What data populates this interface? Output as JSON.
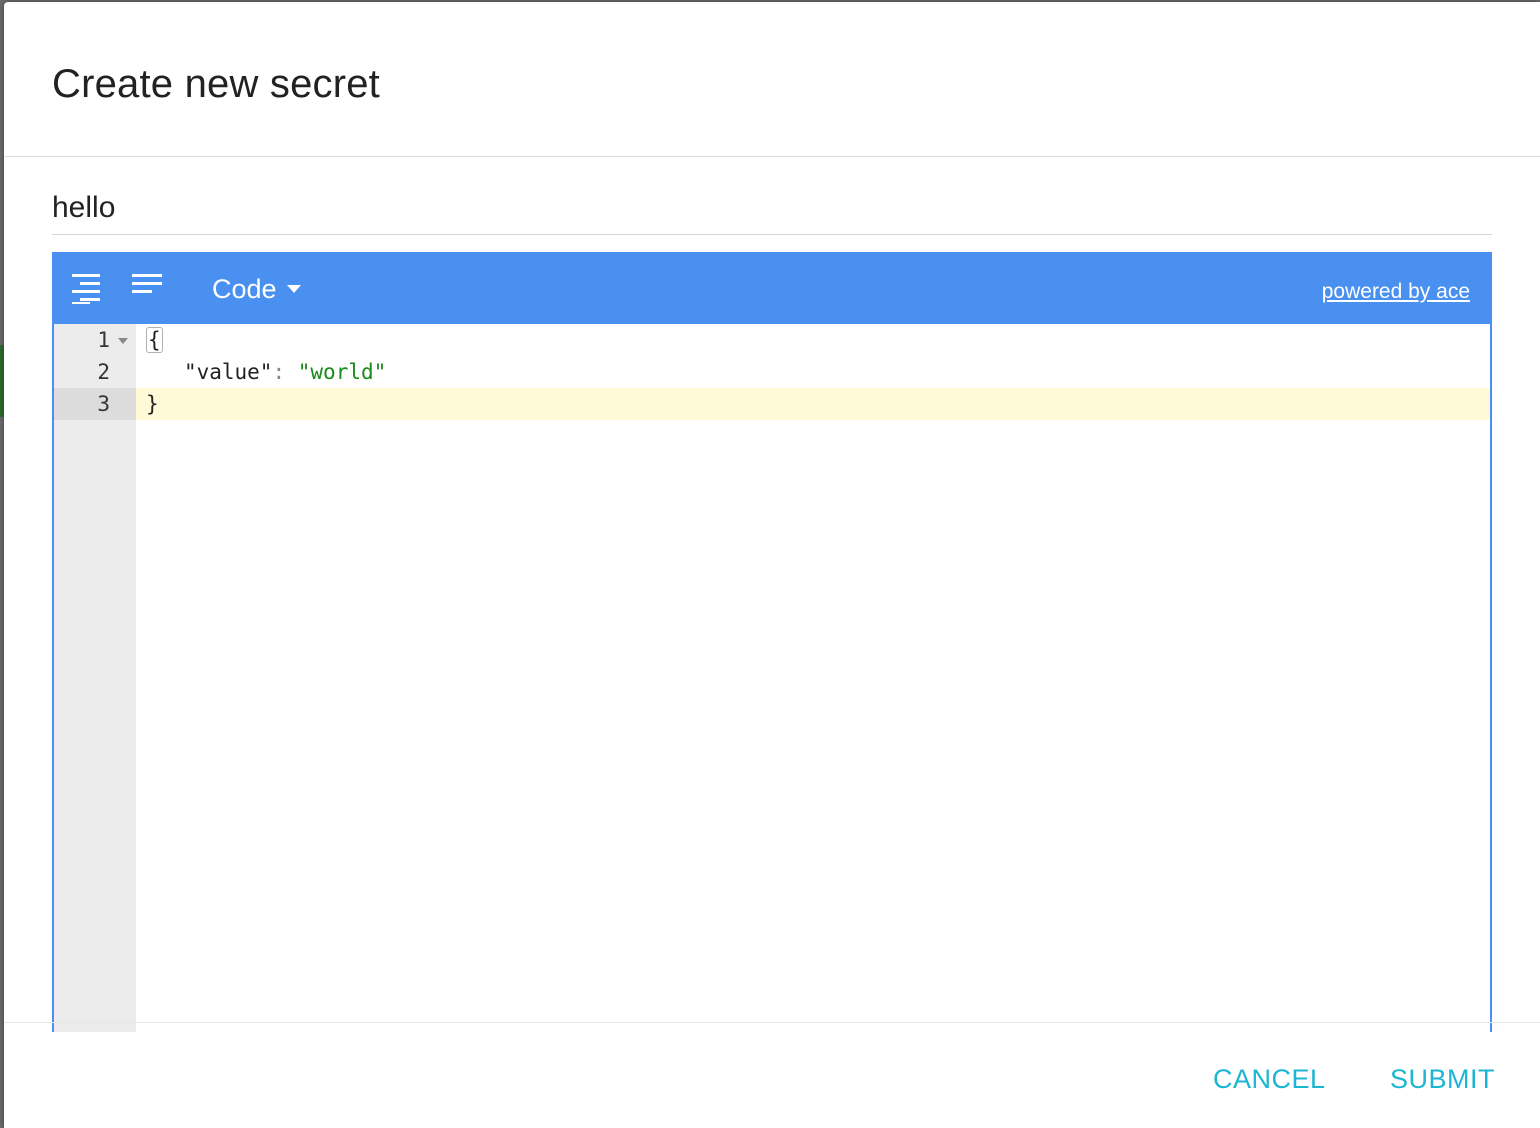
{
  "dialog": {
    "title": "Create new secret"
  },
  "secret_name": {
    "value": "hello"
  },
  "editor": {
    "toolbar": {
      "format_icon": "format-align-icon",
      "compact_icon": "compact-align-icon",
      "mode_label": "Code",
      "powered_by": "powered by ace"
    },
    "line_numbers": [
      "1",
      "2",
      "3"
    ],
    "active_line": 3,
    "lines": {
      "l1_open": "{",
      "l2_key": "\"value\"",
      "l2_colon": ":",
      "l2_value": "\"world\"",
      "l3_close": "}"
    }
  },
  "footer": {
    "cancel_label": "CANCEL",
    "submit_label": "SUBMIT"
  },
  "colors": {
    "toolbar": "#4a90f0",
    "action": "#1cb6d4",
    "string": "#1a8a1a",
    "active_line": "#fefad8"
  }
}
